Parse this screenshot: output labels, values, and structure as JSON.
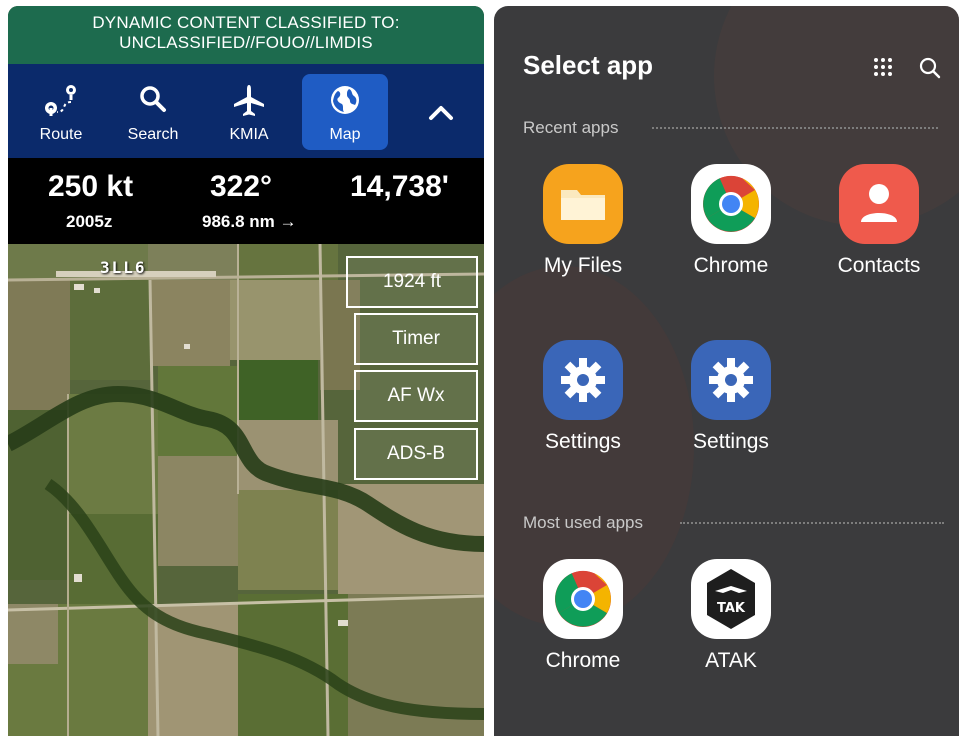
{
  "efb": {
    "banner": {
      "line1": "DYNAMIC CONTENT CLASSIFIED TO:",
      "line2": "UNCLASSIFIED//FOUO//LIMDIS"
    },
    "toolbar": {
      "route": "Route",
      "search": "Search",
      "kmia": "KMIA",
      "map": "Map"
    },
    "readout": {
      "speed": "250 kt",
      "time": "2005z",
      "heading": "322°",
      "distance": "986.8 nm →",
      "altitude": "14,738'"
    },
    "map": {
      "airport_label": "3LL6",
      "altitude_button": "1924 ft",
      "timer_button": "Timer",
      "afwx_button": "AF Wx",
      "adsb_button": "ADS-B"
    }
  },
  "chooser": {
    "title": "Select app",
    "recent_label": "Recent apps",
    "most_used_label": "Most used apps",
    "recent_apps": [
      {
        "label": "My Files",
        "icon": "folder-icon"
      },
      {
        "label": "Chrome",
        "icon": "chrome-icon"
      },
      {
        "label": "Contacts",
        "icon": "contacts-icon"
      },
      {
        "label": "Settings",
        "icon": "gear-icon"
      },
      {
        "label": "Settings",
        "icon": "gear-icon"
      }
    ],
    "most_used_apps": [
      {
        "label": "Chrome",
        "icon": "chrome-icon"
      },
      {
        "label": "ATAK",
        "icon": "atak-icon",
        "logo_text": "TAK"
      }
    ]
  },
  "colors": {
    "banner_green": "#1d6b4e",
    "toolbar_navy": "#0b2a6b",
    "active_tab_blue": "#1f5cc4",
    "chooser_bg": "#3b3b3d",
    "files_orange": "#f6a31d",
    "contacts_red": "#ef5a4c",
    "settings_blue": "#3a66b8"
  }
}
